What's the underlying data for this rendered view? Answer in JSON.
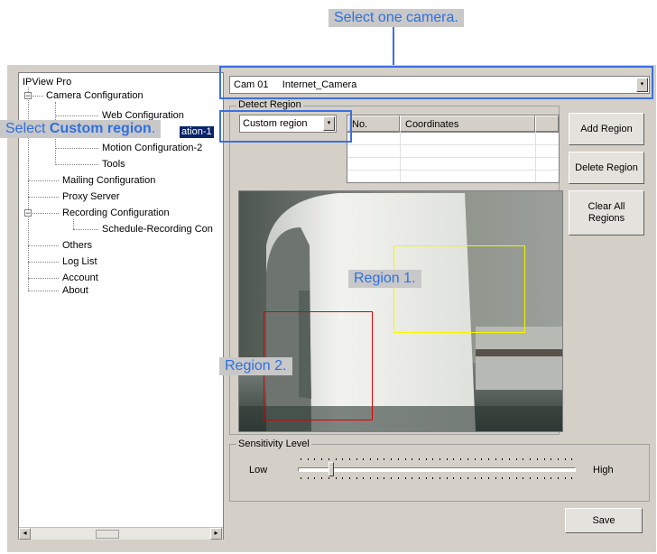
{
  "tree": {
    "root": "IPView Pro",
    "items": [
      {
        "label": "Camera Configuration"
      },
      {
        "label": "Web Configuration"
      },
      {
        "label": "Motion Configuration-1"
      },
      {
        "label": "Motion Configuration-2"
      },
      {
        "label": "Tools"
      },
      {
        "label": "Mailing Configuration"
      },
      {
        "label": "Proxy Server"
      },
      {
        "label": "Recording Configuration"
      },
      {
        "label": "Schedule-Recording Con"
      },
      {
        "label": "Others"
      },
      {
        "label": "Log List"
      },
      {
        "label": "Account"
      },
      {
        "label": "About"
      }
    ],
    "selected_visible": "ation-1"
  },
  "camera_select": {
    "value": "Cam 01     Internet_Camera"
  },
  "detect_region": {
    "title": "Detect Region",
    "mode": "Custom region",
    "columns": [
      "No.",
      "Coordinates"
    ]
  },
  "buttons": {
    "add_region": "Add Region",
    "delete_region": "Delete Region",
    "clear_all": "Clear All Regions",
    "save": "Save"
  },
  "sensitivity": {
    "title": "Sensitivity Level",
    "low": "Low",
    "high": "High",
    "level": 0.12
  },
  "annotations": {
    "select_camera": "Select one camera",
    "select_custom_prefix": "Select ",
    "select_custom_bold": "Custom region",
    "region1": "Region 1",
    "region2": "Region 2",
    "period": "."
  },
  "colors": {
    "annotation_blue": "#3d6fe0",
    "region1": "#ffff00",
    "region2": "#ff0000"
  }
}
